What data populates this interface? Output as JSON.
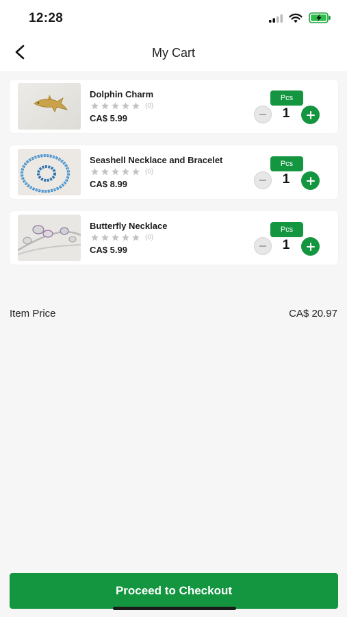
{
  "status_bar": {
    "time": "12:28",
    "icons": [
      "signal-icon",
      "wifi-icon",
      "battery-charging-icon"
    ]
  },
  "header": {
    "title": "My Cart",
    "back_icon": "chevron-left-icon"
  },
  "cart_items": [
    {
      "name": "Dolphin Charm",
      "rating_count": "(0)",
      "rating_stars": 0,
      "price": "CA$ 5.99",
      "unit": "Pcs",
      "quantity": "1"
    },
    {
      "name": "Seashell Necklace and Bracelet",
      "rating_count": "(0)",
      "rating_stars": 0,
      "price": "CA$ 8.99",
      "unit": "Pcs",
      "quantity": "1"
    },
    {
      "name": "Butterfly Necklace",
      "rating_count": "(0)",
      "rating_stars": 0,
      "price": "CA$ 5.99",
      "unit": "Pcs",
      "quantity": "1"
    }
  ],
  "summary": {
    "label": "Item Price",
    "value": "CA$ 20.97"
  },
  "checkout": {
    "label": "Proceed to Checkout"
  },
  "colors": {
    "accent": "#14953f",
    "background": "#f6f6f6",
    "card": "#ffffff",
    "star_empty": "#c4c4c4"
  }
}
